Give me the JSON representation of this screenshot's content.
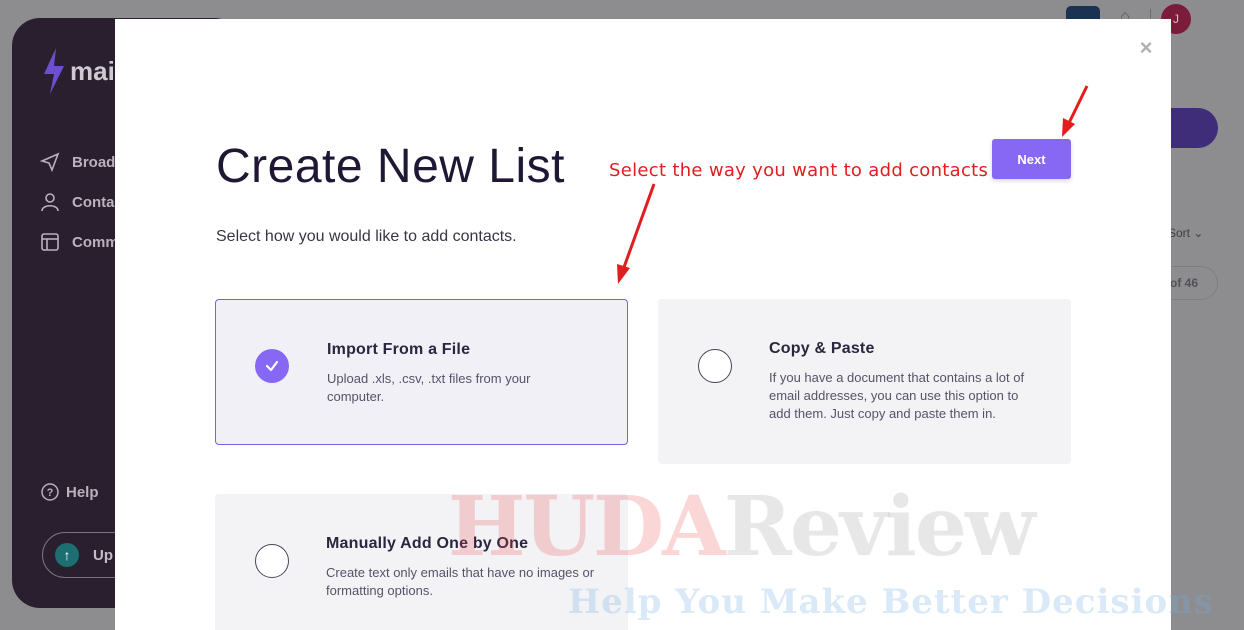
{
  "background": {
    "logo_text": "mai",
    "sidebar": {
      "items": [
        {
          "label": "Broad",
          "icon": "send-icon"
        },
        {
          "label": "Conta",
          "icon": "user-icon"
        },
        {
          "label": "Comm",
          "icon": "layout-icon"
        }
      ],
      "help_label": "Help",
      "upgrade_label": "Up"
    },
    "avatar_initial": "J",
    "sort_label": "Sort",
    "count_label": "of 46"
  },
  "modal": {
    "title": "Create New List",
    "subtitle": "Select how you would like to add contacts.",
    "next_label": "Next",
    "close_label": "×",
    "options": [
      {
        "title": "Import From a File",
        "desc": "Upload .xls, .csv, .txt files from your computer.",
        "selected": true
      },
      {
        "title": "Copy & Paste",
        "desc": "If you have a document that contains a lot of email addresses, you can use this option to add them. Just copy and paste them in.",
        "selected": false
      },
      {
        "title": "Manually Add One by One",
        "desc": "Create text only emails that have no images or formatting options.",
        "selected": false
      }
    ]
  },
  "annotation": {
    "text": "Select the way you want to add contacts",
    "color": "#e01e1e"
  },
  "watermark": {
    "brand_part1": "HUDA",
    "brand_part2": "Review",
    "tagline": "Help You Make Better Decisions"
  },
  "colors": {
    "accent": "#8668f5",
    "title": "#1f1733",
    "sidebar": "#2a1f2f"
  }
}
